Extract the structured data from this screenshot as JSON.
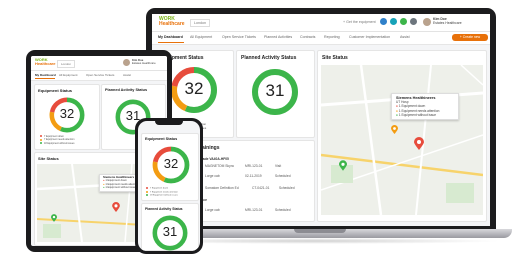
{
  "app": {
    "logo_line1": "WORK",
    "logo_line2": "Healthcare",
    "location_select": "London",
    "user_name": "Kim Doe",
    "user_role": "Estates Healthcare",
    "action_button": "+ Create new",
    "equipment_button": "+ Get the equipment"
  },
  "nav": {
    "items": [
      "My Dashboard",
      "All Equipment",
      "Open Service Tickets",
      "Planned Activities",
      "Contracts",
      "Reporting",
      "Customer Implementation",
      "Assist"
    ]
  },
  "equipment_status": {
    "title": "Equipment Status",
    "value": "32",
    "legend": [
      "7 Equipment down",
      "7 Equipment needs attention",
      "18 Equipment without issues"
    ]
  },
  "planned_activity": {
    "title": "Planned Activity Status",
    "value": "31"
  },
  "site_status": {
    "title": "Site Status",
    "popup_title": "Siemens Healthineers",
    "popup_sub": "UT Hosp",
    "popup_lines": [
      "1 Equipment down",
      "1 Equipment needs attention",
      "1 Equipment without issue"
    ]
  },
  "trainings": {
    "title": "and Trainings",
    "rows": [
      {
        "name": "ware upgrade VA40A-HF05",
        "a": "MAGNETOM Skyra",
        "b": "MRI-123-01",
        "c": "Visit"
      },
      {
        "name": "",
        "a": "Lorge cab",
        "b": "02-11-2019",
        "c": "Scheduled"
      },
      {
        "name": "",
        "a": "Somatom Definition Ed",
        "b": "CT-0421-01",
        "c": "Scheduled"
      },
      {
        "name": "Maintenance",
        "a": "",
        "b": "",
        "c": ""
      },
      {
        "name": "",
        "a": "Lorge cab",
        "b": "MRI-123-01",
        "c": "Scheduled"
      }
    ]
  },
  "colors": {
    "green": "#3cb54a",
    "orange": "#f39c12",
    "red": "#e74c3c",
    "accent": "#e8710a"
  }
}
